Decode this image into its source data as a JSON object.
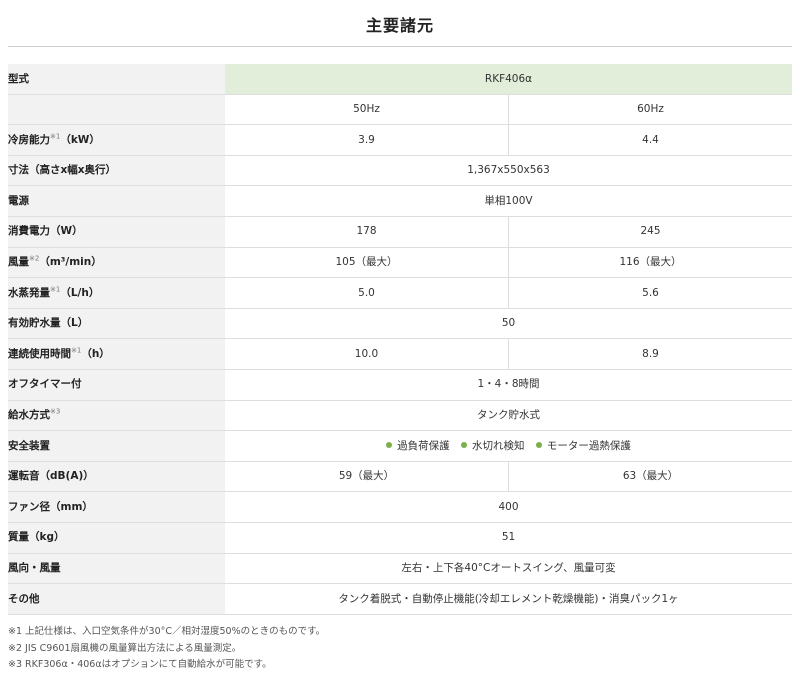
{
  "title": "主要諸元",
  "specs": {
    "model": {
      "label": "型式",
      "value": "RKF406α"
    },
    "freq": {
      "left": "50Hz",
      "right": "60Hz"
    },
    "cooling": {
      "label": "冷房能力",
      "note": "※1",
      "unit": "（kW）",
      "left": "3.9",
      "right": "4.4"
    },
    "size": {
      "label": "寸法（高さx幅x奥行）",
      "value": "1,367x550x563"
    },
    "power": {
      "label": "電源",
      "value": "単相100V"
    },
    "consumption": {
      "label": "消費電力（W）",
      "left": "178",
      "right": "245"
    },
    "airflow": {
      "label": "風量",
      "note": "※2",
      "unit": "（m³/min）",
      "left": "105（最大）",
      "right": "116（最大）"
    },
    "evaporation": {
      "label": "水蒸発量",
      "note": "※1",
      "unit": "（L/h）",
      "left": "5.0",
      "right": "5.6"
    },
    "tank": {
      "label": "有効貯水量（L）",
      "value": "50"
    },
    "continuous": {
      "label": "連続使用時間",
      "note": "※1",
      "unit": "（h）",
      "left": "10.0",
      "right": "8.9"
    },
    "timer": {
      "label": "オフタイマー付",
      "value": "1・4・8時間"
    },
    "water_supply": {
      "label": "給水方式",
      "note": "※3",
      "value": "タンク貯水式"
    },
    "safety": {
      "label": "安全装置",
      "items": [
        "過負荷保護",
        "水切れ検知",
        "モーター過熱保護"
      ]
    },
    "noise": {
      "label": "運転音（dB(A)）",
      "left": "59（最大）",
      "right": "63（最大）"
    },
    "fan": {
      "label": "ファン径（mm）",
      "value": "400"
    },
    "mass": {
      "label": "質量（kg）",
      "value": "51"
    },
    "direction": {
      "label": "風向・風量",
      "value": "左右・上下各40°Cオートスイング、風量可変"
    },
    "other": {
      "label": "その他",
      "value": "タンク着脱式・自動停止機能(冷却エレメント乾燥機能)・消臭パック1ヶ"
    }
  },
  "notes": [
    "※1 上記仕様は、入口空気条件が30°C／相対湿度50%のときのものです。",
    "※2 JIS C9601扇風機の風量算出方法による風量測定。",
    "※3 RKF306α・406αはオプションにて自動給水が可能です。"
  ],
  "colors": {
    "model_bg": "#e3eeda",
    "label_bg": "#f2f2f2",
    "bullet": "#7cae4b"
  }
}
